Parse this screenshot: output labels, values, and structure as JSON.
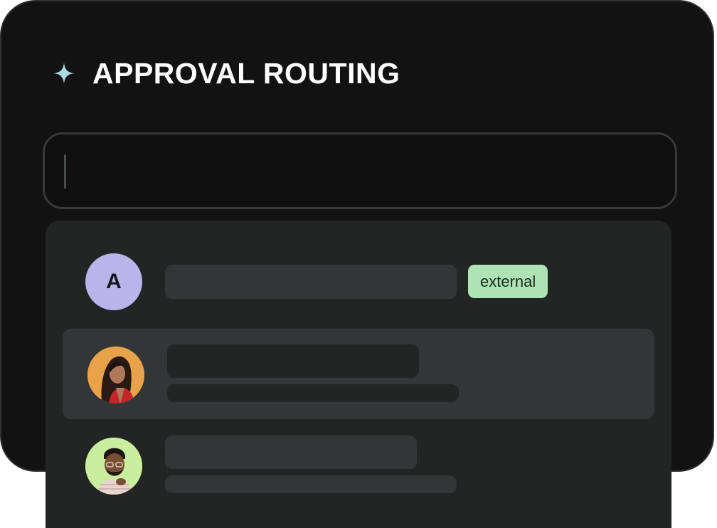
{
  "header": {
    "title": "APPROVAL ROUTING",
    "icon": "sparkle-icon",
    "icon_color": "#a8dce8"
  },
  "search": {
    "value": "",
    "placeholder": ""
  },
  "results": [
    {
      "avatar_initial": "A",
      "avatar_color": "#b9b4ea",
      "badge": "external",
      "badge_color": "#aee3b5"
    },
    {
      "avatar_icon": "person-photo-woman",
      "avatar_color": "#e8a24a",
      "highlighted": true
    },
    {
      "avatar_icon": "person-photo-man",
      "avatar_color": "#c9ef9e"
    }
  ],
  "colors": {
    "card_bg": "#121212",
    "dropdown_bg": "#232424",
    "highlight_bg": "#333636",
    "skeleton": "#323535"
  }
}
